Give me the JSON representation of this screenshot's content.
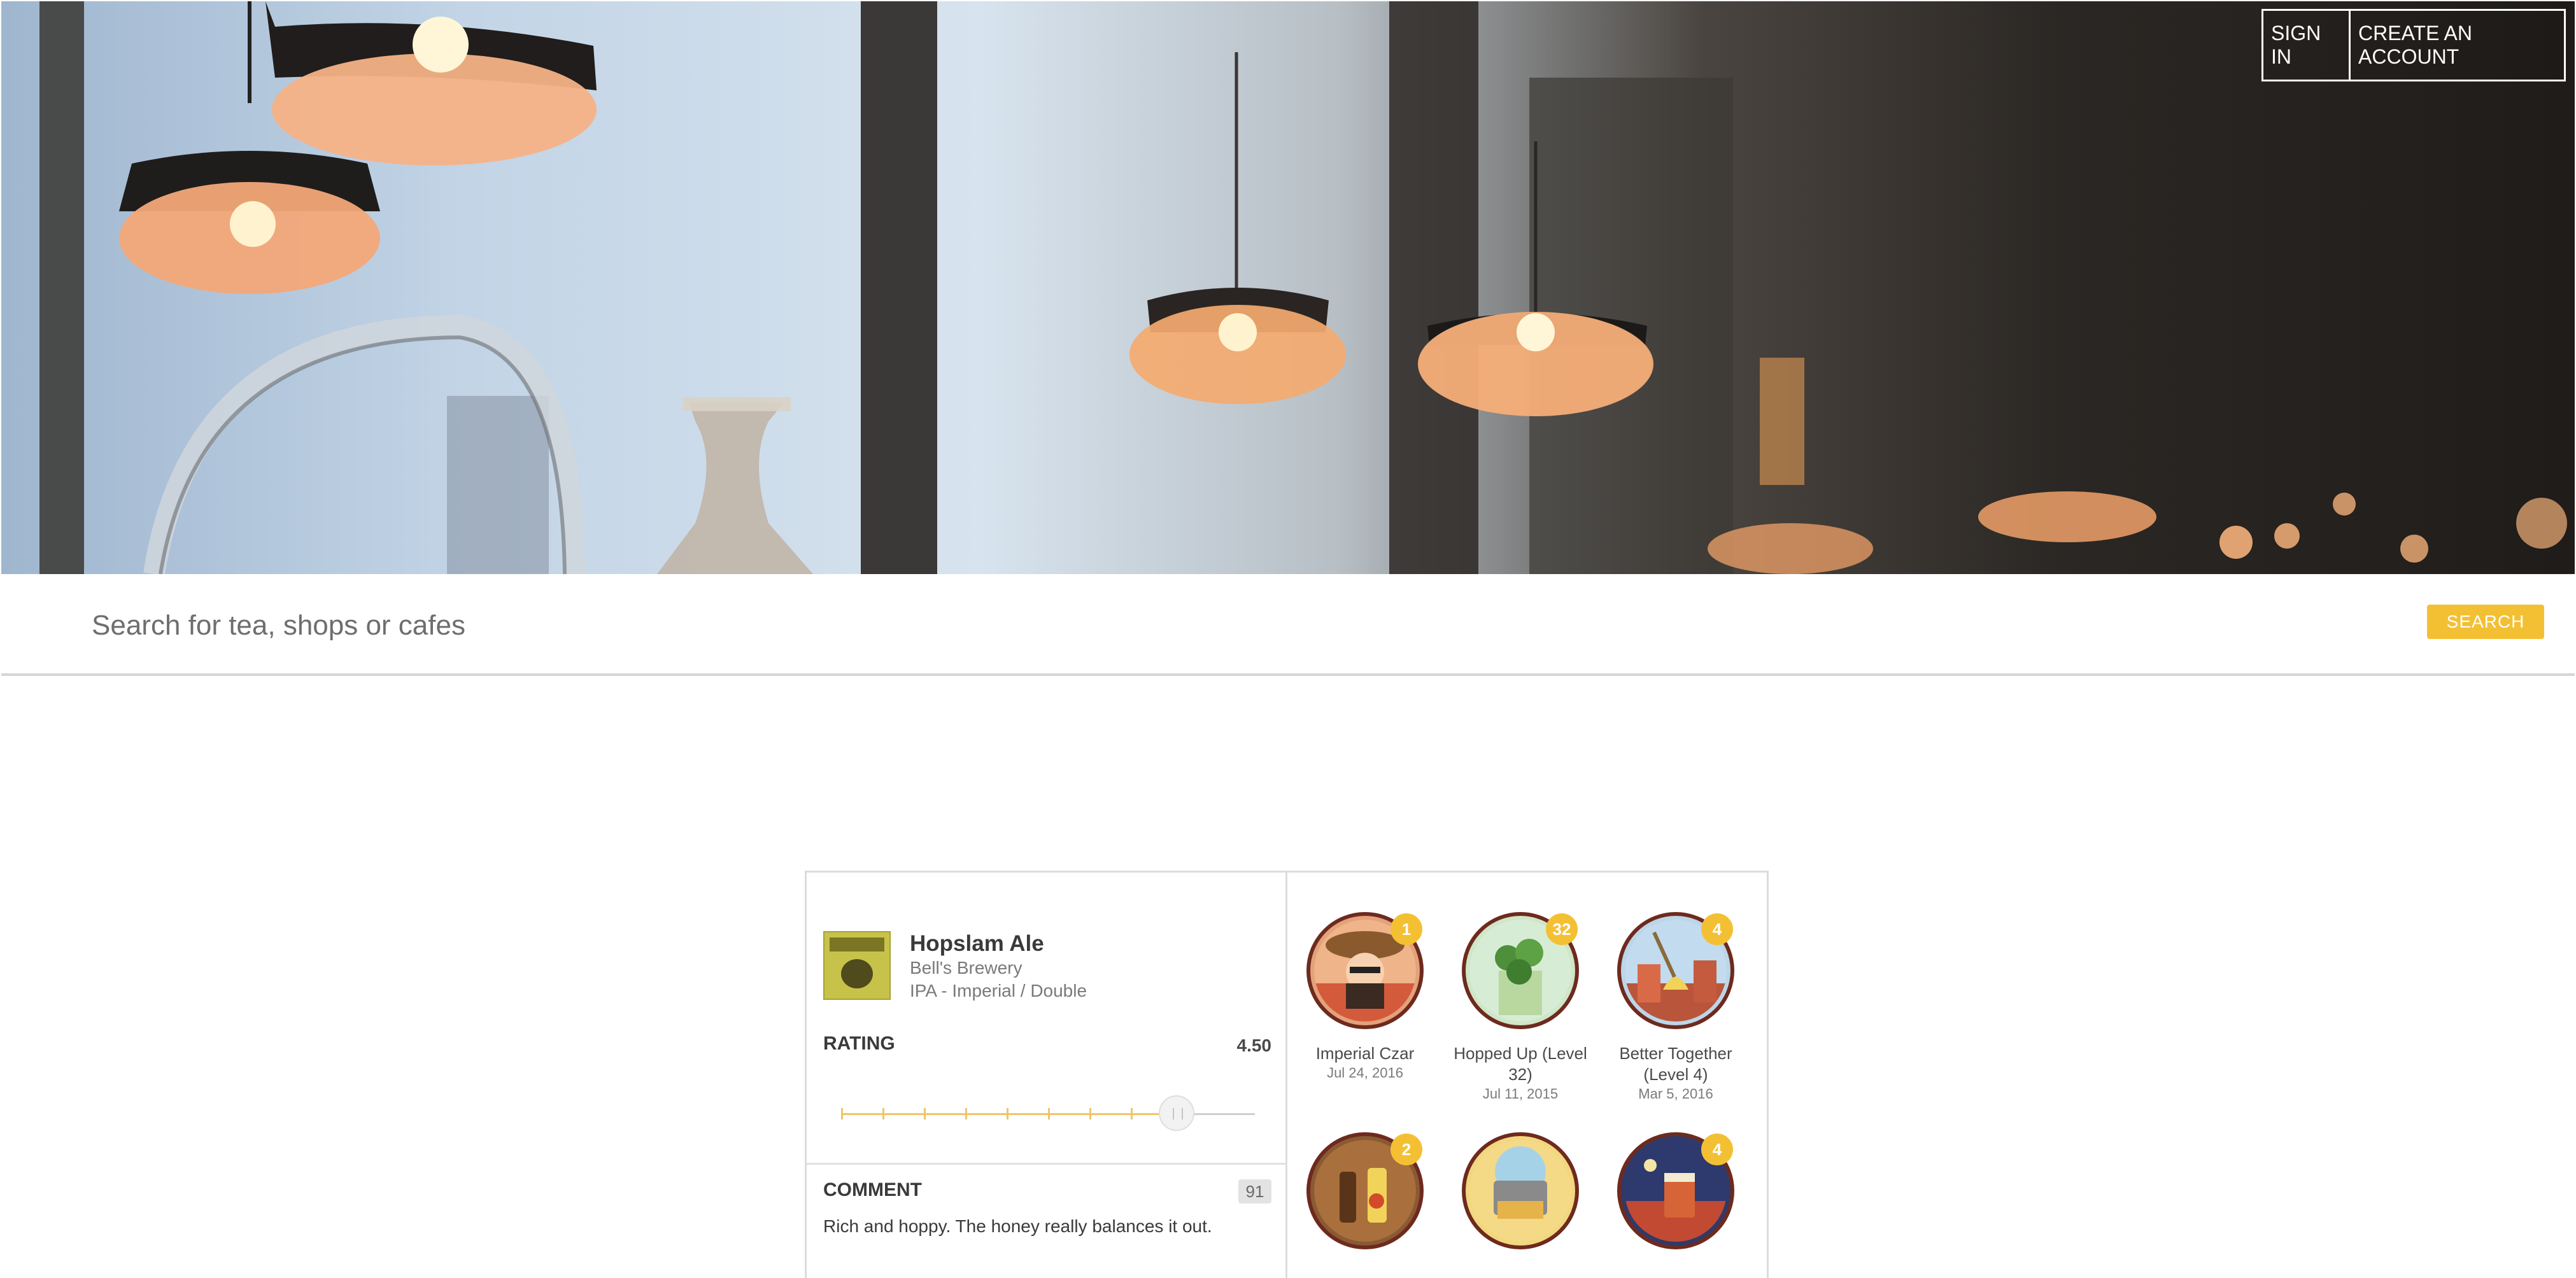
{
  "header": {
    "sign_in": "SIGN IN",
    "create_account": "CREATE AN ACCOUNT"
  },
  "search": {
    "placeholder": "Search for tea, shops or cafes",
    "button": "SEARCH"
  },
  "checkin": {
    "beer_name": "Hopslam Ale",
    "brewery": "Bell's Brewery",
    "style": "IPA - Imperial / Double",
    "rating_label": "RATING",
    "rating_value": "4.50",
    "rating_fraction": 0.9,
    "comment_label": "COMMENT",
    "comment_count": "91",
    "comment_text": "Rich and hoppy. The honey really balances it out."
  },
  "badges": [
    {
      "name": "Imperial Czar",
      "date": "Jul 24, 2016",
      "count": "1",
      "icon": "czar-badge-icon"
    },
    {
      "name": "Hopped Up (Level 32)",
      "date": "Jul 11, 2015",
      "count": "32",
      "icon": "hops-badge-icon"
    },
    {
      "name": "Better Together (Level 4)",
      "date": "Mar 5, 2016",
      "count": "4",
      "icon": "celebration-badge-icon"
    },
    {
      "name": "",
      "date": "",
      "count": "2",
      "icon": "bottles-badge-icon"
    },
    {
      "name": "",
      "date": "",
      "count": "",
      "icon": "lunchbox-badge-icon"
    },
    {
      "name": "",
      "date": "",
      "count": "4",
      "icon": "night-beer-badge-icon"
    }
  ],
  "colors": {
    "accent": "#f4c033",
    "badge_ring": "#6e2a1e"
  }
}
